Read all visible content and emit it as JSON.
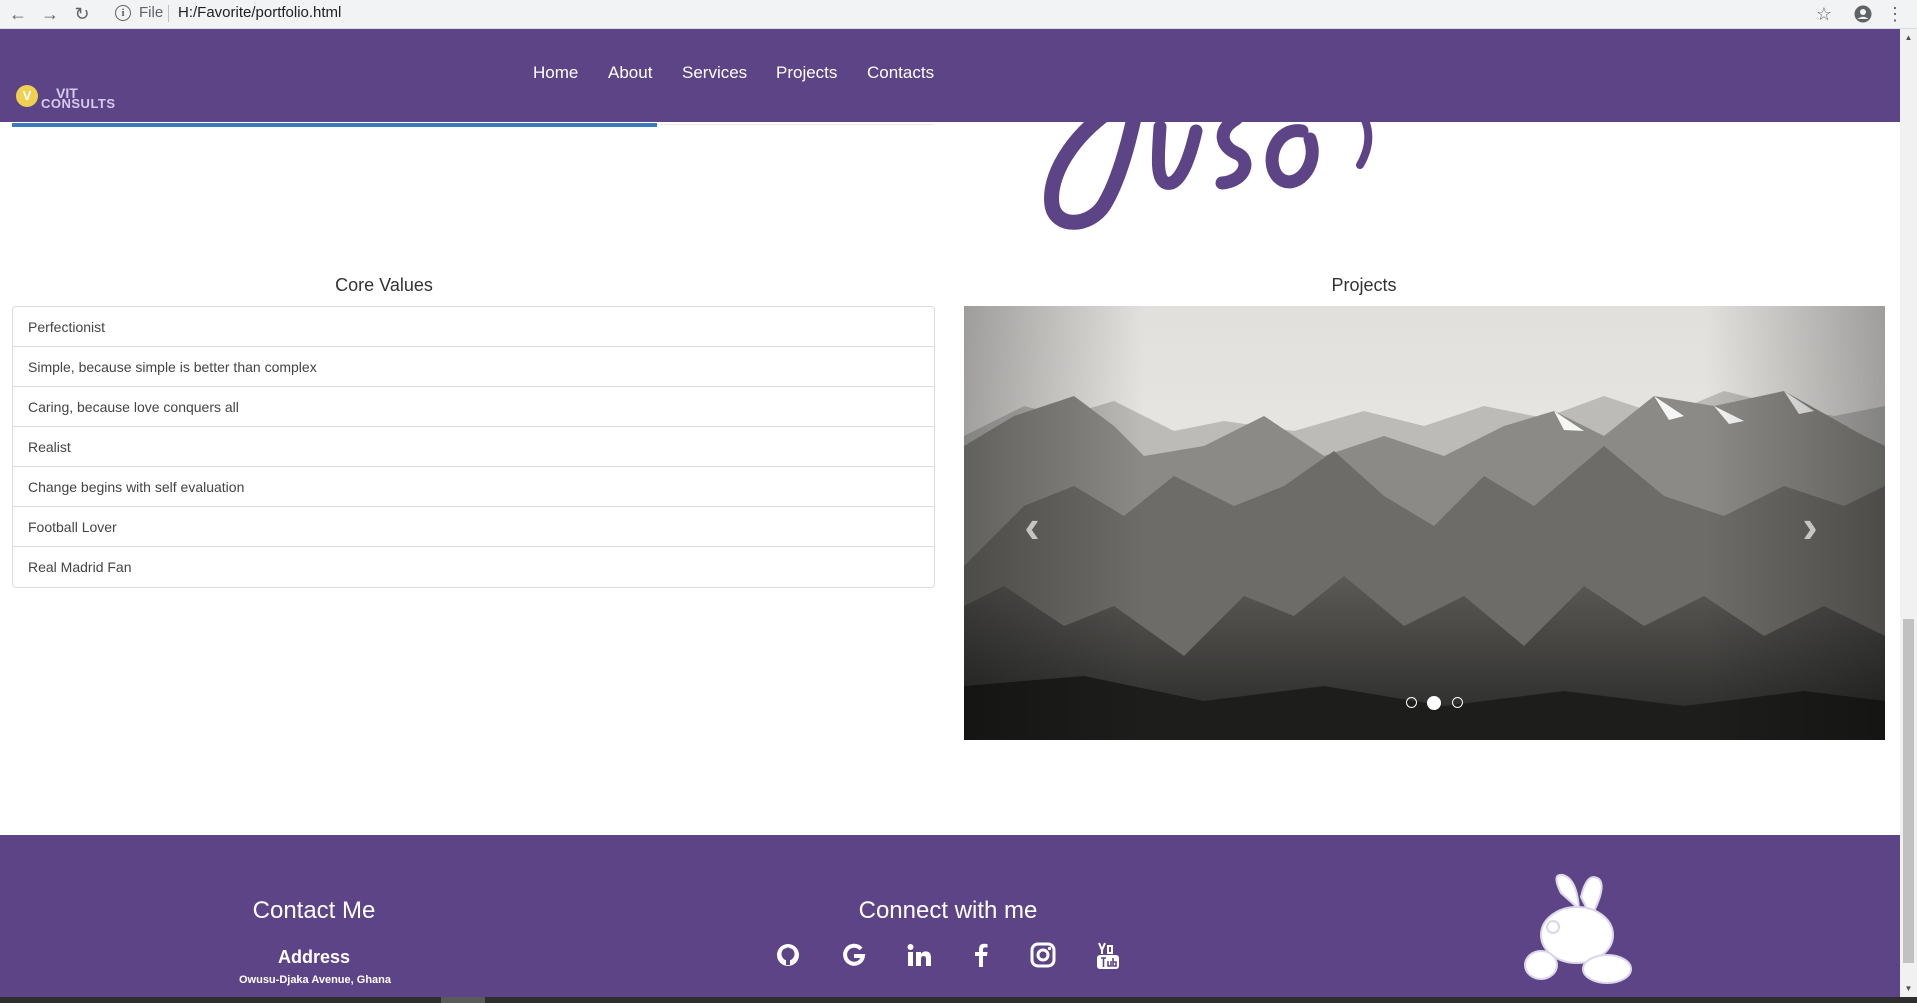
{
  "browser": {
    "back_icon": "arrow-left-icon",
    "forward_icon": "arrow-right-icon",
    "reload_icon": "reload-icon",
    "info_icon": "info-icon",
    "scheme_label": "File",
    "url": "H:/Favorite/portfolio.html",
    "bookmark_icon": "star-icon",
    "account_icon": "account-icon",
    "menu_icon": "kebab-menu-icon"
  },
  "navbar": {
    "logo": {
      "line1": "VIT",
      "line2": "CONSULTS"
    },
    "links": [
      "Home",
      "About",
      "Services",
      "Projects",
      "Contacts"
    ]
  },
  "core_values": {
    "title": "Core Values",
    "items": [
      "Perfectionist",
      "Simple, because simple is better than complex",
      "Caring, because love conquers all",
      "Realist",
      "Change begins with self evaluation",
      "Football Lover",
      "Real Madrid Fan"
    ]
  },
  "projects": {
    "title": "Projects",
    "carousel": {
      "slide_count": 3,
      "active_index": 1,
      "prev_icon": "chevron-left-icon",
      "next_icon": "chevron-right-icon"
    }
  },
  "footer": {
    "contact_title": "Contact Me",
    "address_label": "Address",
    "address_value": "Owusu-Djaka Avenue, Ghana",
    "connect_title": "Connect with me",
    "social_icons": [
      "github-icon",
      "google-icon",
      "linkedin-icon",
      "facebook-icon",
      "instagram-icon",
      "youtube-icon"
    ],
    "mascot": "rabbit-icon"
  },
  "colors": {
    "brand_purple": "#5d4486",
    "accent_blue": "#3a7bbf",
    "logo_yellow": "#f0d050"
  }
}
